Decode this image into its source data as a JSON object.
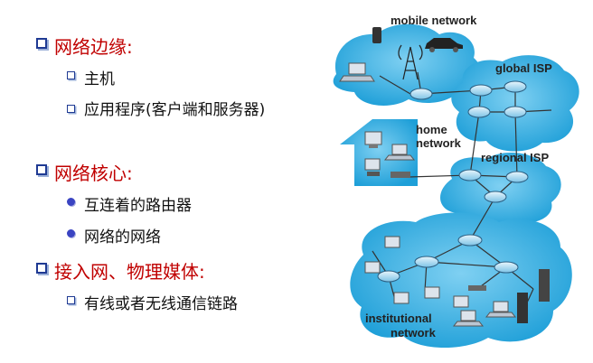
{
  "outline": {
    "edge": "网络边缘:",
    "host": "主机",
    "apps": "应用程序(客户端和服务器)",
    "core": "网络核心:",
    "routers": "互连着的路由器",
    "net_of_nets": "网络的网络",
    "access": "接入网、物理媒体:",
    "links": "有线或者无线通信链路"
  },
  "diagram": {
    "mobile": "mobile network",
    "global_isp": "global ISP",
    "home_1": "home",
    "home_2": "network",
    "regional_isp": "regional ISP",
    "inst_1": "institutional",
    "inst_2": "network"
  },
  "colors": {
    "accent": "#c00000",
    "bullet": "#1f3a93",
    "cloud": "#29a9e1"
  }
}
